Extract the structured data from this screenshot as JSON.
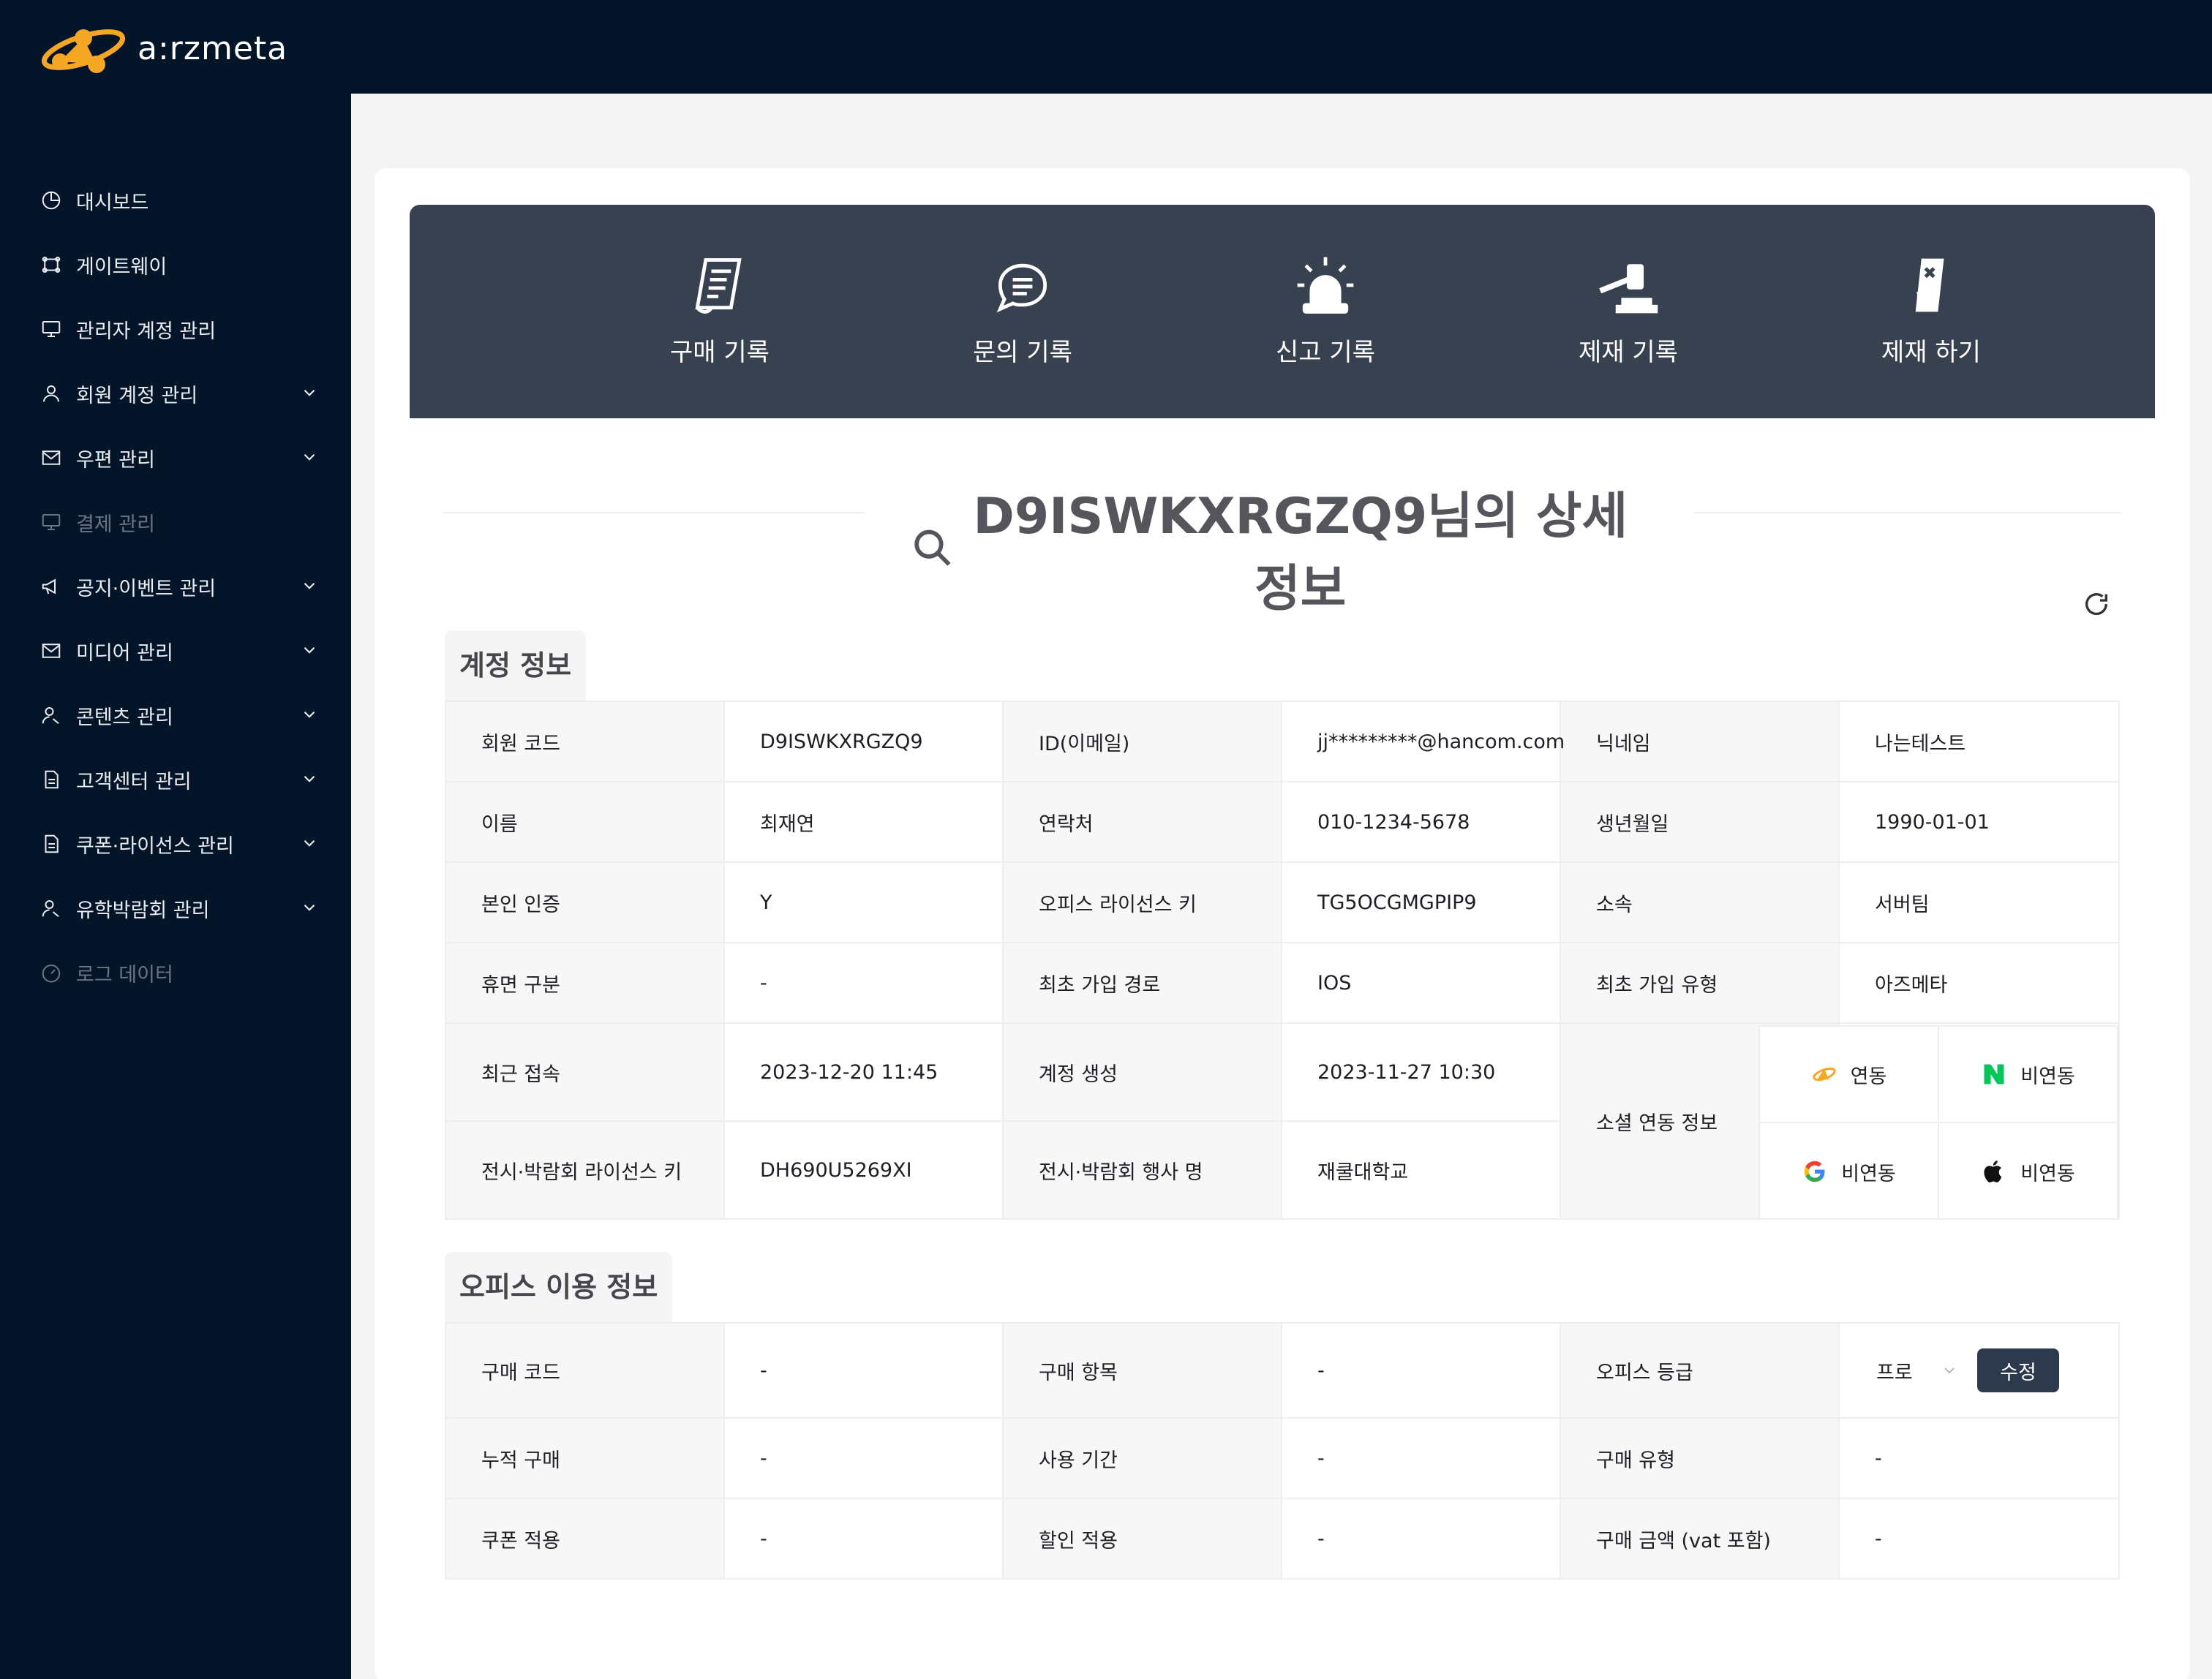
{
  "app": {
    "logo_text": "a:rzmeta"
  },
  "sidebar": {
    "items": [
      {
        "label": "대시보드",
        "icon": "pie-chart-icon",
        "expandable": false,
        "disabled": false
      },
      {
        "label": "게이트웨이",
        "icon": "gateway-icon",
        "expandable": false,
        "disabled": false
      },
      {
        "label": "관리자 계정 관리",
        "icon": "monitor-icon",
        "expandable": false,
        "disabled": false
      },
      {
        "label": "회원 계정 관리",
        "icon": "user-icon",
        "expandable": true,
        "disabled": false
      },
      {
        "label": "우편 관리",
        "icon": "mail-icon",
        "expandable": true,
        "disabled": false
      },
      {
        "label": "결제 관리",
        "icon": "monitor-icon",
        "expandable": false,
        "disabled": true
      },
      {
        "label": "공지·이벤트 관리",
        "icon": "megaphone-icon",
        "expandable": true,
        "disabled": false
      },
      {
        "label": "미디어 관리",
        "icon": "mail-icon",
        "expandable": true,
        "disabled": false
      },
      {
        "label": "콘텐츠 관리",
        "icon": "users-icon",
        "expandable": true,
        "disabled": false
      },
      {
        "label": "고객센터 관리",
        "icon": "document-icon",
        "expandable": true,
        "disabled": false
      },
      {
        "label": "쿠폰·라이선스 관리",
        "icon": "document-icon",
        "expandable": true,
        "disabled": false
      },
      {
        "label": "유학박람회 관리",
        "icon": "users-icon",
        "expandable": true,
        "disabled": false
      },
      {
        "label": "로그 데이터",
        "icon": "gauge-icon",
        "expandable": false,
        "disabled": true
      }
    ]
  },
  "actions": [
    {
      "label": "구매 기록",
      "icon": "receipt-icon"
    },
    {
      "label": "문의 기록",
      "icon": "chat-bubble-icon"
    },
    {
      "label": "신고 기록",
      "icon": "siren-icon"
    },
    {
      "label": "제재 기록",
      "icon": "gavel-icon"
    },
    {
      "label": "제재 하기",
      "icon": "ban-card-icon"
    }
  ],
  "page_title": "D9ISWKXRGZQ9님의 상세 정보",
  "account_section": {
    "title": "계정 정보",
    "rows": [
      [
        "회원 코드",
        "D9ISWKXRGZQ9",
        "ID(이메일)",
        "jj*********@hancom.com",
        "닉네임",
        "나는테스트"
      ],
      [
        "이름",
        "최재연",
        "연락처",
        "010-1234-5678",
        "생년월일",
        "1990-01-01"
      ],
      [
        "본인 인증",
        "Y",
        "오피스 라이선스 키",
        "TG5OCGMGPIP9",
        "소속",
        "서버팀"
      ],
      [
        "휴면 구분",
        "-",
        "최초 가입 경로",
        "IOS",
        "최초 가입 유형",
        "아즈메타"
      ],
      [
        "최근 접속",
        "2023-12-20 11:45",
        "계정 생성",
        "2023-11-27 10:30"
      ],
      [
        "전시·박람회 라이선스 키",
        "DH690U5269XI",
        "전시·박람회 행사 명",
        "재쿨대학교"
      ]
    ],
    "social_label": "소셜 연동 정보",
    "social": [
      {
        "provider_icon": "arzmeta-icon",
        "status": "연동"
      },
      {
        "provider_icon": "naver-icon",
        "status": "비연동"
      },
      {
        "provider_icon": "google-icon",
        "status": "비연동"
      },
      {
        "provider_icon": "apple-icon",
        "status": "비연동"
      }
    ]
  },
  "office_section": {
    "title": "오피스 이용 정보",
    "rows": [
      [
        "구매 코드",
        "-",
        "구매 항목",
        "-",
        "오피스 등급"
      ],
      [
        "누적 구매",
        "-",
        "사용 기간",
        "-",
        "구매 유형",
        "-"
      ],
      [
        "쿠폰 적용",
        "-",
        "할인 적용",
        "-",
        "구매 금액 (vat 포함)",
        "-"
      ]
    ],
    "grade_value": "프로",
    "edit_label": "수정"
  },
  "colors": {
    "sidebar_bg": "#041529",
    "action_bar_bg": "#384150",
    "accent": "#f5a623",
    "button_bg": "#2d3a4d"
  }
}
